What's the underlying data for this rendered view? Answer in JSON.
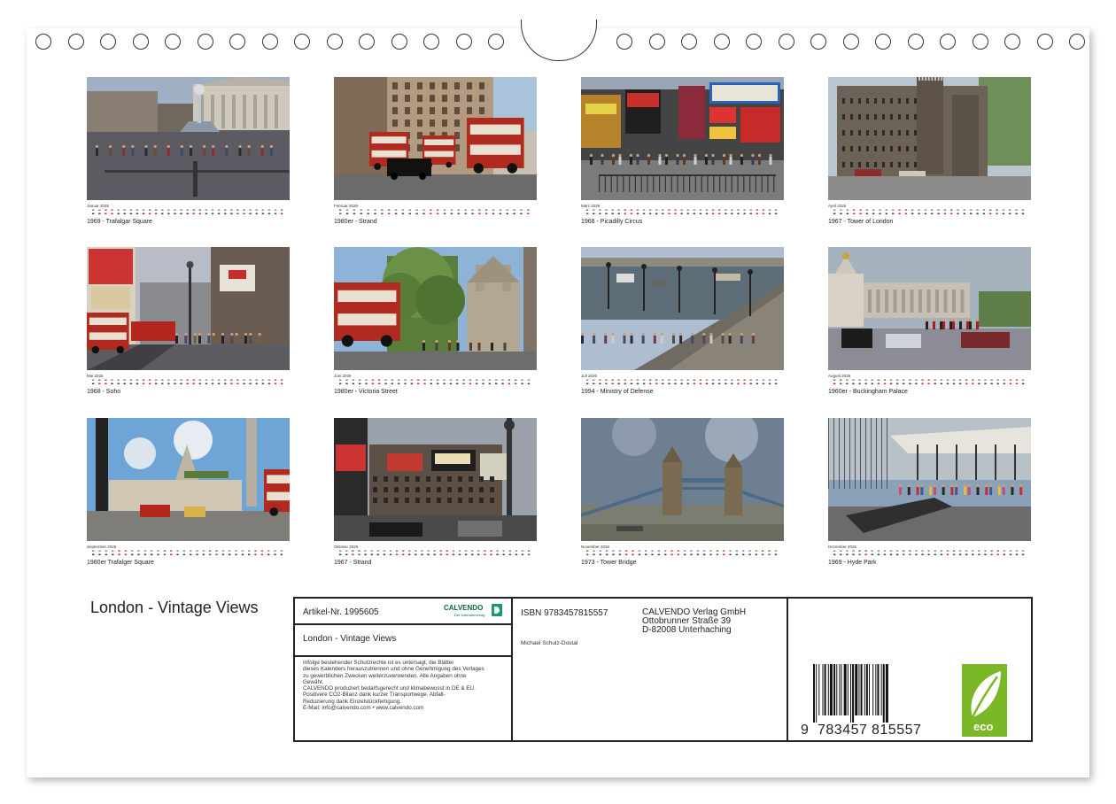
{
  "months": [
    {
      "month": "Januar 2026",
      "caption": "1969 - Trafalgar Square",
      "scene": "square"
    },
    {
      "month": "Februar 2026",
      "caption": "1980er - Strand",
      "scene": "strand"
    },
    {
      "month": "März 2026",
      "caption": "1968 - Picadilly Circus",
      "scene": "piccadilly"
    },
    {
      "month": "April 2026",
      "caption": "1967 - Tower of London",
      "scene": "tower"
    },
    {
      "month": "Mai 2026",
      "caption": "1968 - Soho",
      "scene": "soho"
    },
    {
      "month": "Juni 2026",
      "caption": "1980er - Victoria Street",
      "scene": "victoria"
    },
    {
      "month": "Juli 2026",
      "caption": "1994 - Ministry of Defense",
      "scene": "river"
    },
    {
      "month": "August 2026",
      "caption": "1960er - Buckingham Palace",
      "scene": "palace"
    },
    {
      "month": "September 2026",
      "caption": "1980er Trafalger Square",
      "scene": "column"
    },
    {
      "month": "Oktober 2026",
      "caption": "1967 - Strand",
      "scene": "strand2"
    },
    {
      "month": "November 2026",
      "caption": "1973 - Tower Bridge",
      "scene": "bridge"
    },
    {
      "month": "Dezember 2026",
      "caption": "1969 - Hyde Park",
      "scene": "park"
    }
  ],
  "book_title": "London - Vintage Views",
  "info": {
    "article": "Artikel-Nr. 1995605",
    "brand": "CALVENDO",
    "brand_sub": "Der Kalenderverlag",
    "title": "London - Vintage Views",
    "notice": [
      "Infolge bestehender Schutzrechte ist es untersagt, die Blätter",
      "dieses Kalenders herauszutrennen und ohne Genehmigung des Verlages",
      "zu gewerblichen Zwecken weiterzuverwenden. Alle Angaben ohne",
      "Gewähr.",
      "CALVENDO produziert bedarfsgerecht und klimabewusst in DE & EU.",
      "Positivere CO2-Bilanz dank kurzer Transportwege. Abfall-",
      "Reduzierung dank Einzelstückfertigung.",
      "E-Mail: info@calvendo.com • www.calvendo.com"
    ],
    "isbn": "ISBN 9783457815557",
    "publisher": [
      "CALVENDO Verlag GmbH",
      "Ottobrunner Straße 39",
      "D-82008 Unterhaching"
    ],
    "author": "Michael Schulz-Dostal",
    "barcode_digits": [
      "9",
      "783457",
      "815557"
    ],
    "eco_label": "eco"
  },
  "colors": {
    "accent_green": "#7ab828",
    "border": "#222222",
    "weekend_red": "#c0392b"
  }
}
